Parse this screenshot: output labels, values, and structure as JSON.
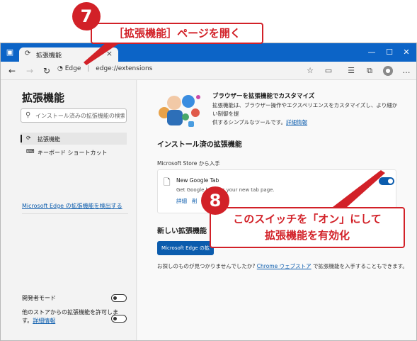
{
  "browser": {
    "tab_title": "拡張機能",
    "tab_close": "×",
    "window_controls": [
      "—",
      "☐",
      "✕"
    ],
    "address": {
      "site_label": "Edge",
      "separator": "|",
      "path": "edge://extensions"
    },
    "icons": {
      "tab_actions": "tab-actions-icon",
      "back": "back-arrow-icon",
      "forward": "forward-arrow-icon",
      "refresh": "refresh-icon",
      "edge_logo": "edge-logo-icon",
      "reading_view": "reading-view-icon",
      "favorite": "star-icon",
      "favorites_list": "favorites-list-icon",
      "collections": "collections-icon",
      "profile": "avatar",
      "menu": "more-menu-icon"
    }
  },
  "sidebar": {
    "title": "拡張機能",
    "search_placeholder": "インストール済みの拡張機能の検索",
    "items": [
      {
        "label": "拡張機能",
        "active": true,
        "icon": "extension-icon"
      },
      {
        "label": "キーボード ショートカット",
        "active": false,
        "icon": "keyboard-icon"
      }
    ],
    "discover_link": "Microsoft Edge の拡張機能を検出する",
    "dev_mode_label": "開発者モード",
    "other_stores_label_line1": "他のストアからの拡張機能を許可しま",
    "other_stores_label_line2_prefix": "す。",
    "other_stores_link": "詳細情報"
  },
  "main": {
    "promo": {
      "title": "ブラウザーを拡張機能でカスタマイズ",
      "desc_line1": "拡張機能は、ブラウザー操作やエクスペリエンスをカスタマイズし、より細かい制御を提",
      "desc_line2_prefix": "供するシンプルなツールです。",
      "desc_link": "詳細情報"
    },
    "installed_heading": "インストール済の拡張機能",
    "store_label": "Microsoft Store から入手",
    "extension": {
      "name": "New Google Tab",
      "description": "Get Google back as your new tab page.",
      "details": "詳細",
      "remove": "削",
      "enabled": true
    },
    "new_heading": "新しい拡張機能",
    "get_button": "Microsoft Edge の拡",
    "find_prefix": "お探しのものが見つかりませんでしたか?",
    "find_link": "Chrome ウェブストア",
    "find_suffix": "で拡張機能を入手することもできます。"
  },
  "callouts": {
    "step7_number": "7",
    "step7_text": "［拡張機能］ページを開く",
    "step8_number": "8",
    "step8_line1": "このスイッチを「オン」にして",
    "step8_line2": "拡張機能を有効化"
  },
  "colors": {
    "accent": "#0b5cad",
    "titlebar": "#0c64c7",
    "callout": "#d22128"
  }
}
